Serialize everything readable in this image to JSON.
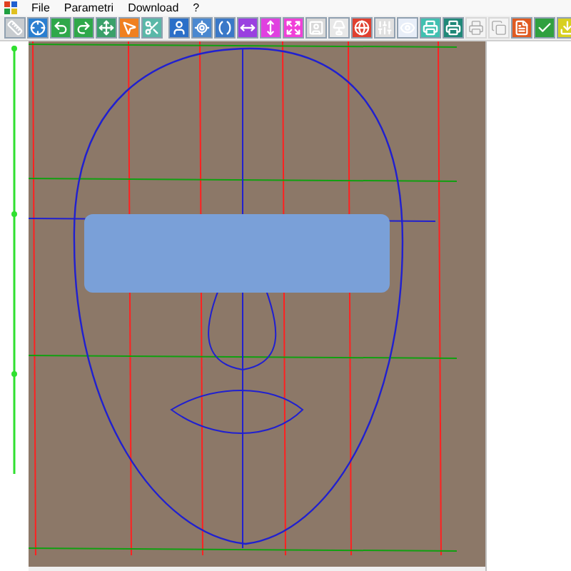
{
  "menu": [
    {
      "label": "File"
    },
    {
      "label": "Parametri"
    },
    {
      "label": "Download"
    },
    {
      "label": "?"
    }
  ],
  "toolbar": [
    {
      "kind": "ruler",
      "disabled": false
    },
    {
      "kind": "crosshair",
      "disabled": false
    },
    {
      "kind": "undo",
      "disabled": false
    },
    {
      "kind": "redo",
      "disabled": false
    },
    {
      "kind": "move",
      "disabled": false
    },
    {
      "kind": "pointer",
      "disabled": false
    },
    {
      "kind": "scissors",
      "disabled": false
    },
    {
      "kind": "person",
      "disabled": false
    },
    {
      "kind": "locate",
      "disabled": false
    },
    {
      "kind": "contour",
      "disabled": false
    },
    {
      "kind": "horizontal",
      "disabled": false
    },
    {
      "kind": "vertical",
      "disabled": false
    },
    {
      "kind": "expand",
      "disabled": false
    },
    {
      "kind": "portrait",
      "disabled": false
    },
    {
      "kind": "lamp",
      "disabled": false
    },
    {
      "kind": "globe",
      "disabled": false
    },
    {
      "kind": "slider",
      "disabled": false
    },
    {
      "kind": "eye",
      "disabled": false
    },
    {
      "kind": "print",
      "disabled": false
    },
    {
      "kind": "print-dark",
      "disabled": false
    },
    {
      "kind": "print",
      "disabled": true
    },
    {
      "kind": "copy",
      "disabled": true
    },
    {
      "kind": "pdf",
      "disabled": false
    },
    {
      "kind": "check",
      "disabled": false
    },
    {
      "kind": "download",
      "disabled": false
    }
  ]
}
